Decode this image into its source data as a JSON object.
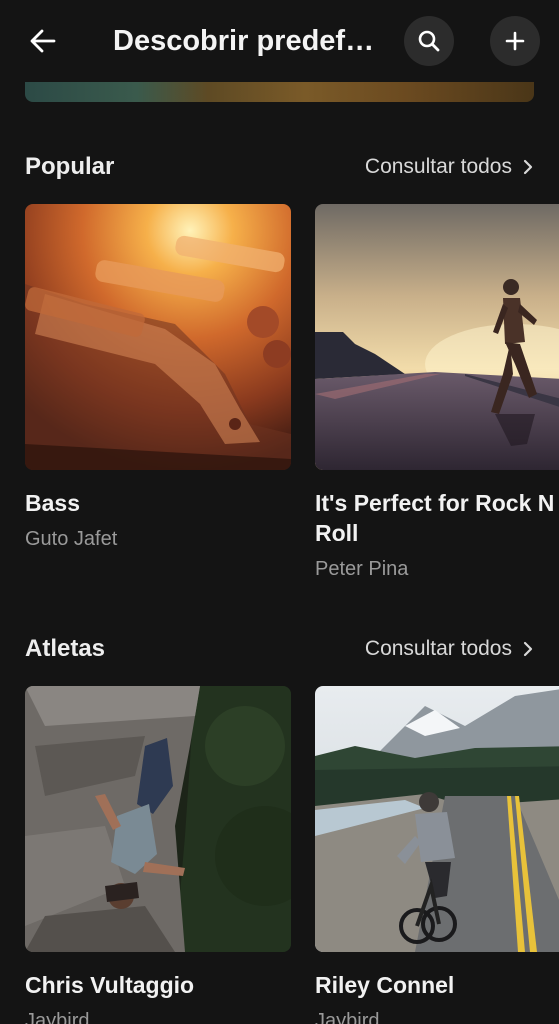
{
  "header": {
    "title": "Descobrir predefi…",
    "back_icon": "arrow-left-icon",
    "search_icon": "search-icon",
    "add_icon": "plus-icon"
  },
  "sections": [
    {
      "title": "Popular",
      "see_all": "Consultar todos",
      "cards": [
        {
          "title": "Bass",
          "subtitle": "Guto Jafet"
        },
        {
          "title": "It's Perfect for Rock N Roll",
          "subtitle": "Peter Pina"
        }
      ]
    },
    {
      "title": "Atletas",
      "see_all": "Consultar todos",
      "cards": [
        {
          "title": "Chris Vultaggio",
          "subtitle": "Jaybird"
        },
        {
          "title": "Riley Connel",
          "subtitle": "Jaybird"
        }
      ]
    }
  ]
}
